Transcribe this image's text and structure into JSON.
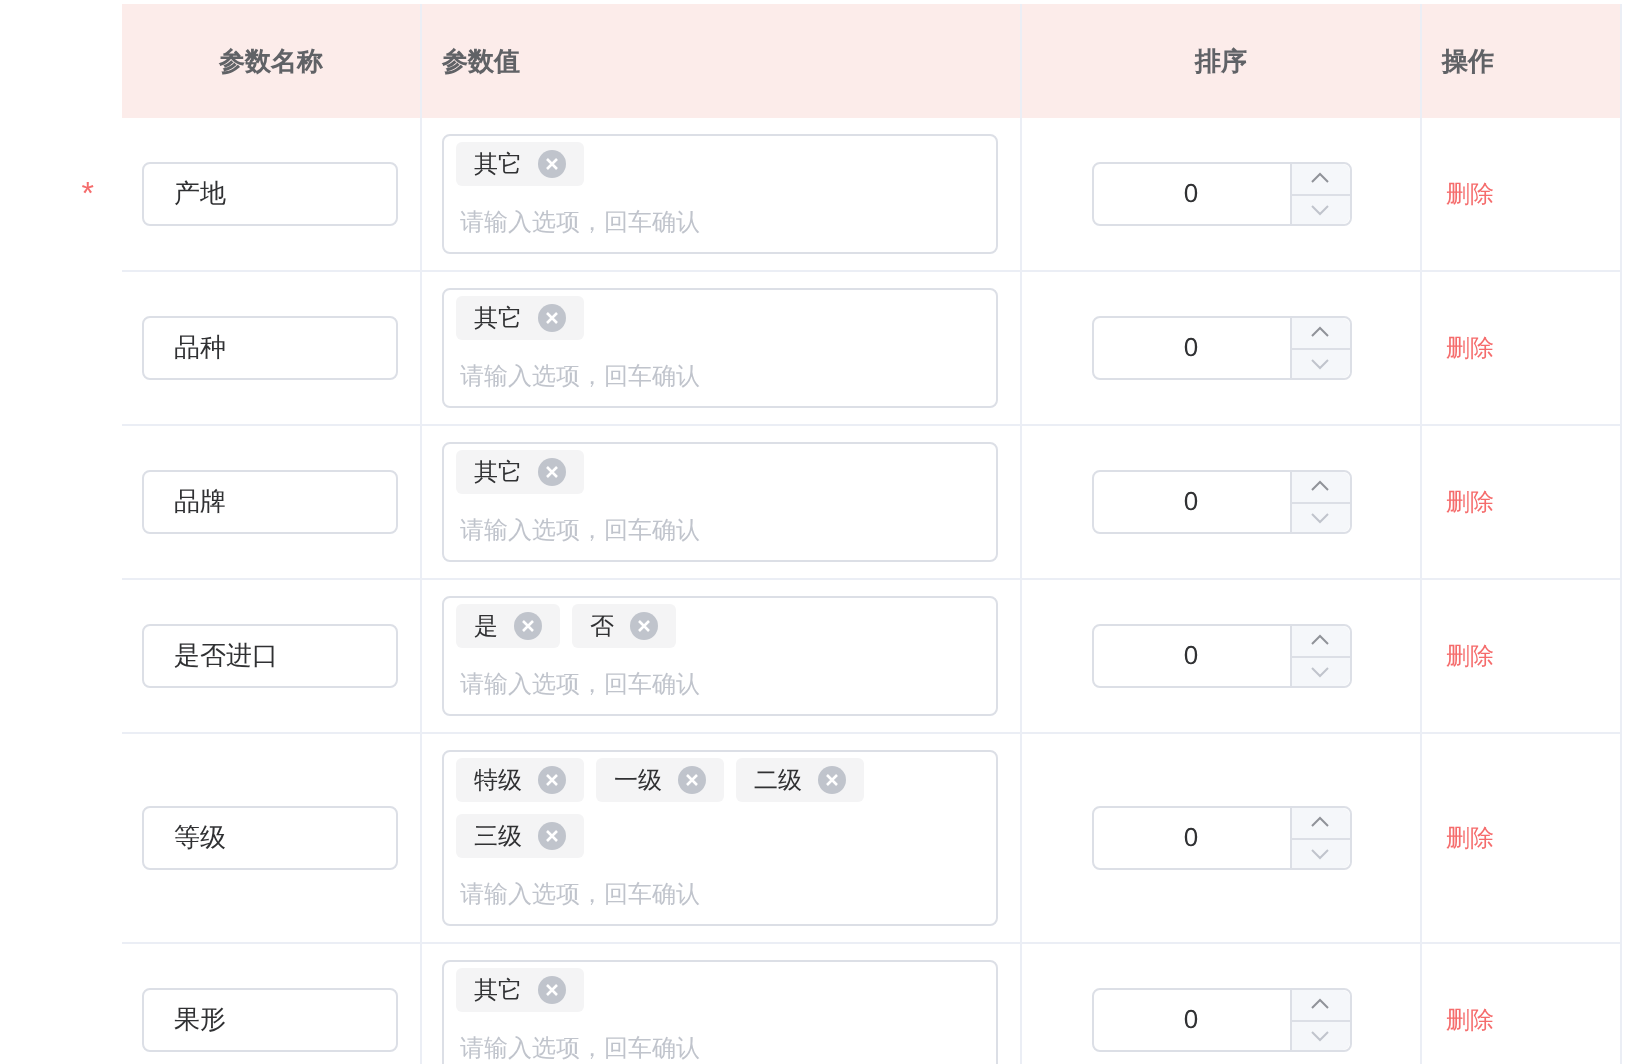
{
  "table": {
    "columns": [
      {
        "label": "参数名称"
      },
      {
        "label": "参数值"
      },
      {
        "label": "排序"
      },
      {
        "label": "操作"
      }
    ],
    "rows": [
      {
        "marker": "*",
        "name": "产地",
        "tags": [
          "其它"
        ],
        "placeholder": "请输入选项，回车确认",
        "sort": "0",
        "action": "删除"
      },
      {
        "name": "品种",
        "tags": [
          "其它"
        ],
        "placeholder": "请输入选项，回车确认",
        "sort": "0",
        "action": "删除"
      },
      {
        "name": "品牌",
        "tags": [
          "其它"
        ],
        "placeholder": "请输入选项，回车确认",
        "sort": "0",
        "action": "删除"
      },
      {
        "name": "是否进口",
        "tags": [
          "是",
          "否"
        ],
        "placeholder": "请输入选项，回车确认",
        "sort": "0",
        "action": "删除"
      },
      {
        "name": "等级",
        "tags": [
          "特级",
          "一级",
          "二级",
          "三级"
        ],
        "placeholder": "请输入选项，回车确认",
        "sort": "0",
        "action": "删除"
      },
      {
        "name": "果形",
        "tags": [
          "其它"
        ],
        "placeholder": "请输入选项，回车确认",
        "sort": "0",
        "action": "删除"
      }
    ]
  }
}
